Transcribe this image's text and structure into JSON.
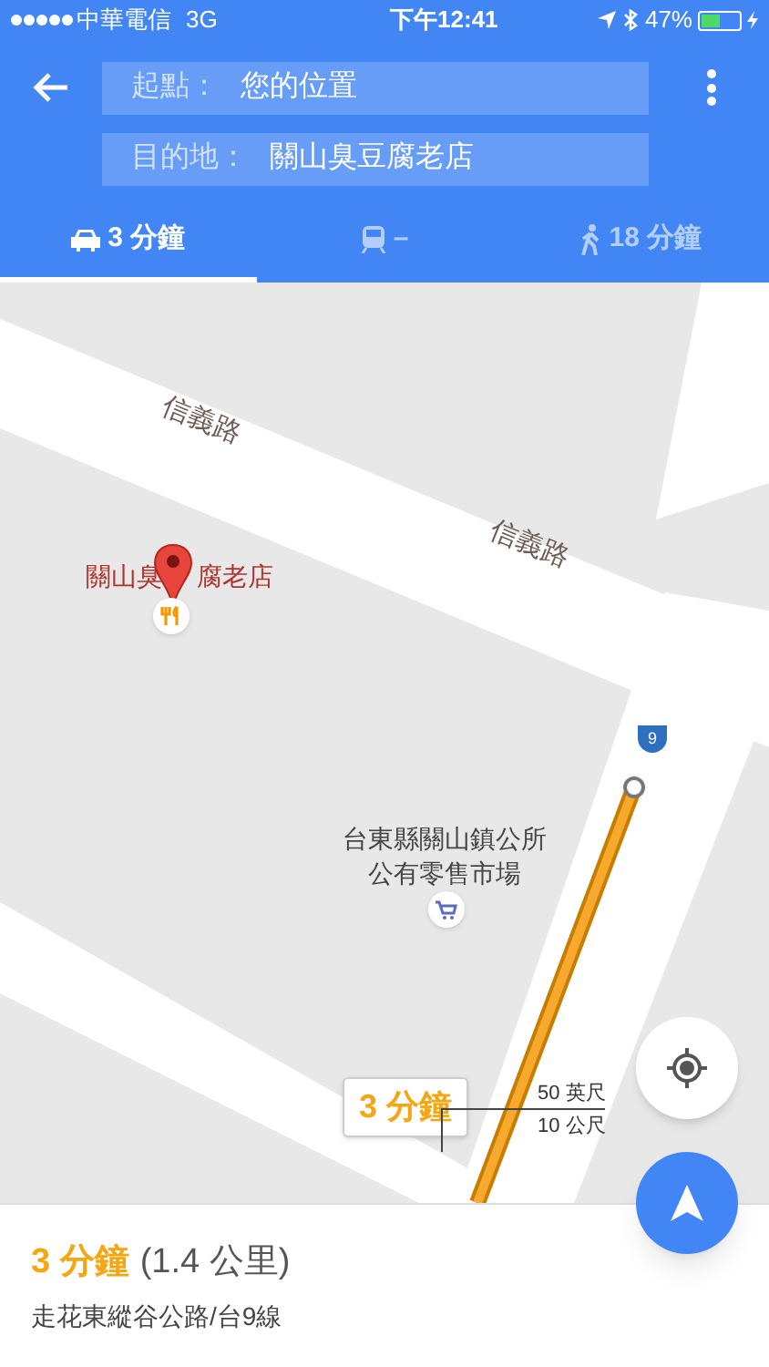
{
  "status_bar": {
    "carrier": "中華電信",
    "network": "3G",
    "time": "下午12:41",
    "battery": "47%"
  },
  "route": {
    "origin_label": "起點：",
    "origin": "您的位置",
    "destination_label": "目的地：",
    "destination": "關山臭豆腐老店"
  },
  "tabs": [
    {
      "kind": "car",
      "label": "3 分鐘",
      "selected": true
    },
    {
      "kind": "transit",
      "label": "–",
      "selected": false
    },
    {
      "kind": "walk",
      "label": "18 分鐘",
      "selected": false
    }
  ],
  "map": {
    "road_labels": [
      "信義路",
      "信義路"
    ],
    "place_name_parts": [
      "關山臭",
      "腐老店"
    ],
    "poi_lines": [
      "台東縣關山鎮公所",
      "公有零售市場"
    ],
    "highway_shield": "9",
    "eta_callout": "3 分鐘",
    "scale": [
      "50 英尺",
      "10 公尺"
    ]
  },
  "summary": {
    "duration": "3 分鐘",
    "distance": "(1.4 公里)",
    "via": "走花東縱谷公路/台9線"
  }
}
